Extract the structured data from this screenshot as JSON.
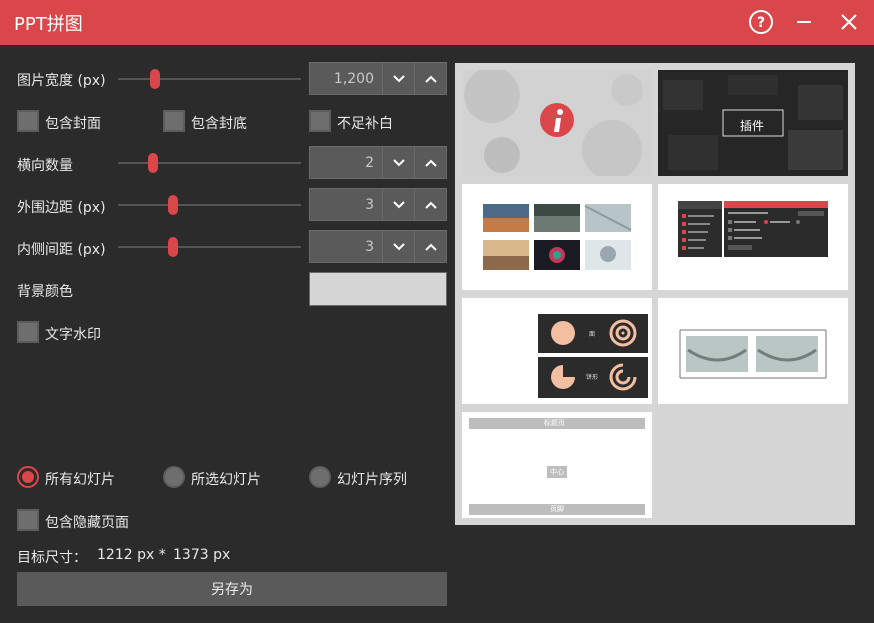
{
  "window": {
    "title": "PPT拼图"
  },
  "form": {
    "image_width_label": "图片宽度 (px)",
    "image_width_value": "1,200",
    "image_width_slider": 0.2,
    "include_cover_label": "包含封面",
    "include_back_label": "包含封底",
    "fill_blank_label": "不足补白",
    "horizontal_count_label": "横向数量",
    "horizontal_count_value": "2",
    "horizontal_count_slider": 0.19,
    "outer_margin_label": "外围边距 (px)",
    "outer_margin_value": "3",
    "outer_margin_slider": 0.3,
    "inner_gap_label": "内侧间距 (px)",
    "inner_gap_value": "3",
    "inner_gap_slider": 0.3,
    "bg_color_label": "背景颜色",
    "bg_color_value": "#d6d6d6",
    "text_watermark_label": "文字水印"
  },
  "slides_scope": {
    "all_label": "所有幻灯片",
    "selected_label": "所选幻灯片",
    "sequence_label": "幻灯片序列",
    "selected": "all"
  },
  "include_hidden_label": "包含隐藏页面",
  "target_size": {
    "label": "目标尺寸：",
    "width": "1212 px *",
    "height": "1373 px"
  },
  "save_as_label": "另存为",
  "preview": {
    "banner_text": "插件",
    "tile_left_label": "标题页",
    "tile_center_label": "中心",
    "tile_bottom_label": "页脚",
    "chart_label_1": "面",
    "chart_label_2": "饼形"
  },
  "colors": {
    "accent": "#d9474a",
    "background": "#2b2b2b",
    "control": "#5a5a5a"
  }
}
